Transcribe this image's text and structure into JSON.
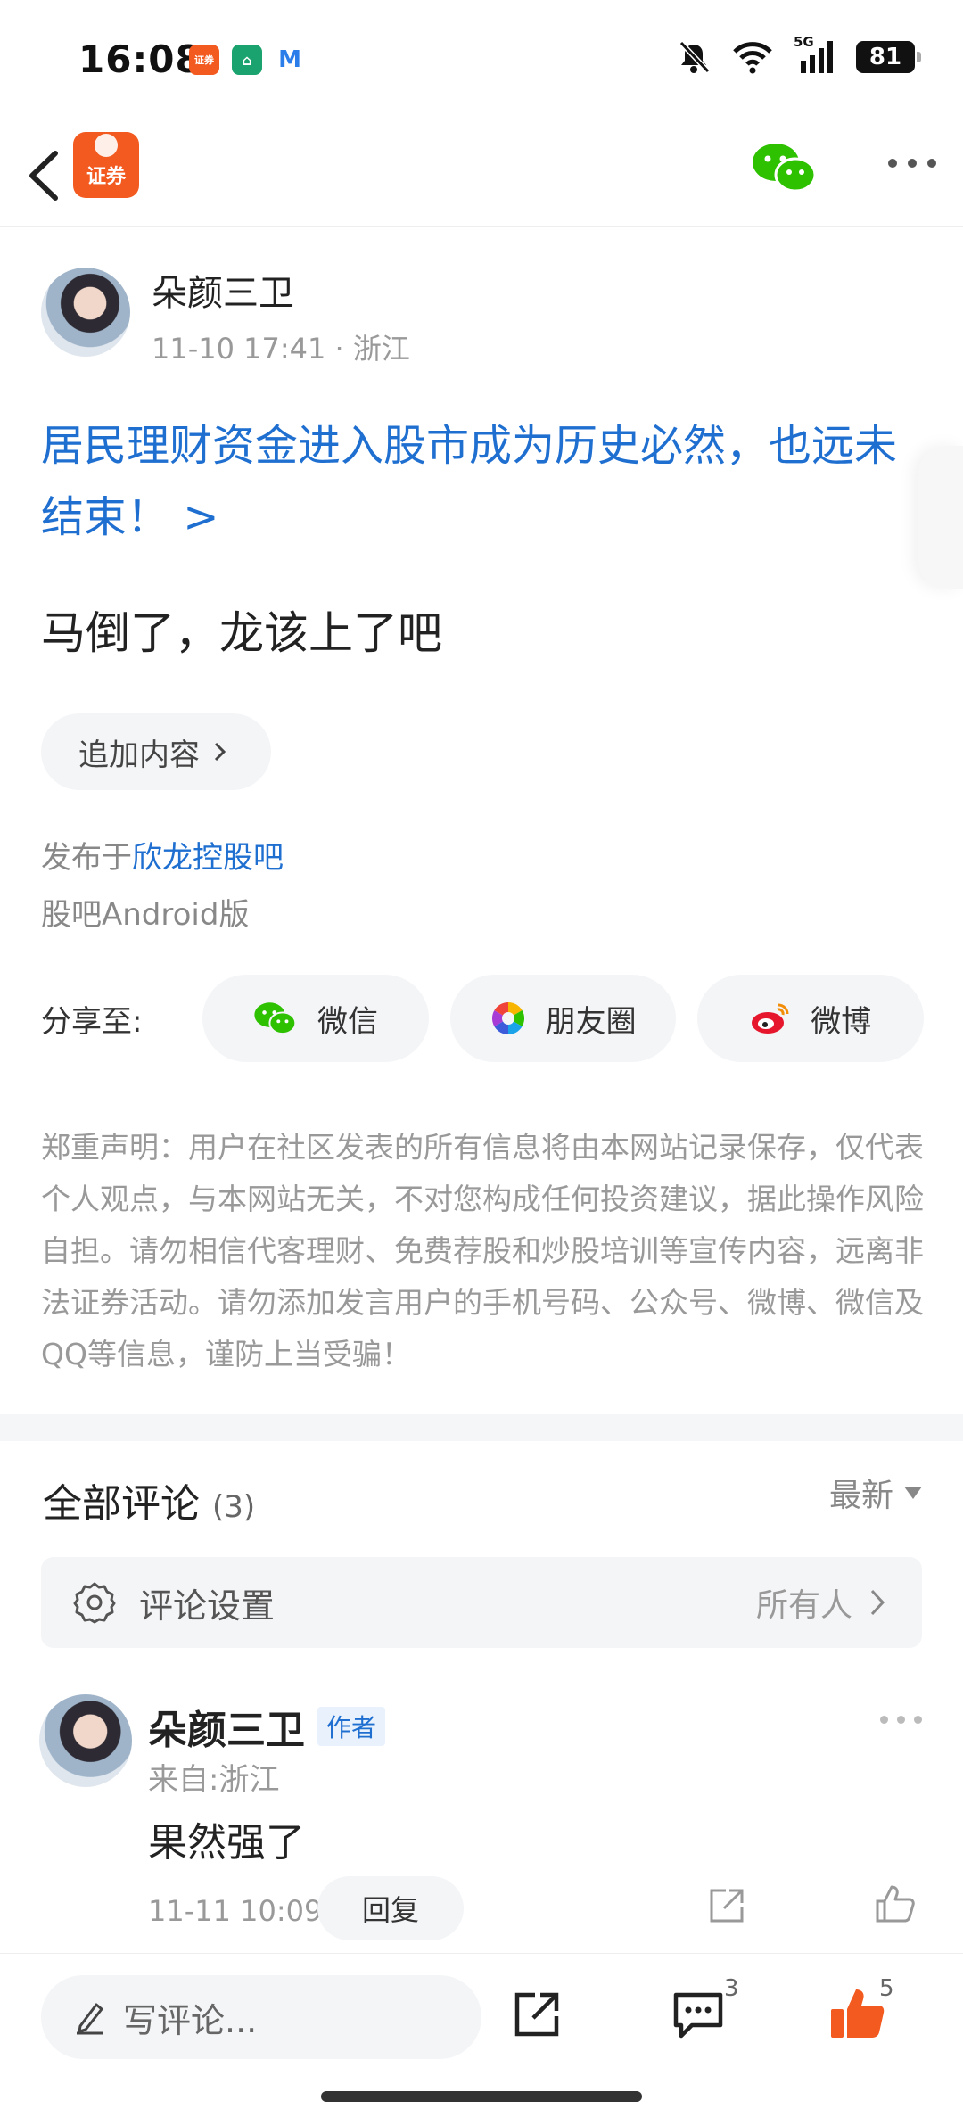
{
  "status_bar": {
    "time": "16:08",
    "apps": [
      {
        "name": "securities-app-icon",
        "label": "证券",
        "color": "#f35a1f"
      },
      {
        "name": "home-app-icon",
        "label": "⌂",
        "color": "#1aa36e"
      },
      {
        "name": "m-app-icon",
        "label": "M",
        "color": "#2b7de9"
      }
    ],
    "network": "5G",
    "battery": "81"
  },
  "navbar": {
    "logo_label": "证券"
  },
  "post": {
    "author": "朵颜三卫",
    "time": "11-10 17:41",
    "location": "· 浙江",
    "headline": "居民理财资金进入股市成为历史必然，也远未结束！ >",
    "body": "马倒了，龙该上了吧",
    "add_content": "追加内容",
    "posted_prefix": "发布于",
    "posted_bar": "欣龙控股吧",
    "device": "股吧Android版"
  },
  "share": {
    "label": "分享至:",
    "wechat": "微信",
    "moments": "朋友圈",
    "weibo": "微博"
  },
  "disclaimer": "郑重声明：用户在社区发表的所有信息将由本网站记录保存，仅代表个人观点，与本网站无关，不对您构成任何投资建议，据此操作风险自担。请勿相信代客理财、免费荐股和炒股培训等宣传内容，远离非法证券活动。请勿添加发言用户的手机号码、公众号、微博、微信及QQ等信息，谨防上当受骗！",
  "comments": {
    "title": "全部评论",
    "count": "(3)",
    "sort": "最新",
    "settings_label": "评论设置",
    "settings_value": "所有人",
    "items": [
      {
        "author": "朵颜三卫",
        "badge": "作者",
        "from": "来自:浙江",
        "text": "果然强了",
        "time": "11-11 10:09",
        "reply": "回复"
      }
    ]
  },
  "bottom_bar": {
    "write_placeholder": "写评论...",
    "comment_count": "3",
    "like_count": "5"
  },
  "colors": {
    "accent_blue": "#1f6fd1",
    "brand_orange": "#f35a1f",
    "wechat_green": "#2dc100"
  }
}
